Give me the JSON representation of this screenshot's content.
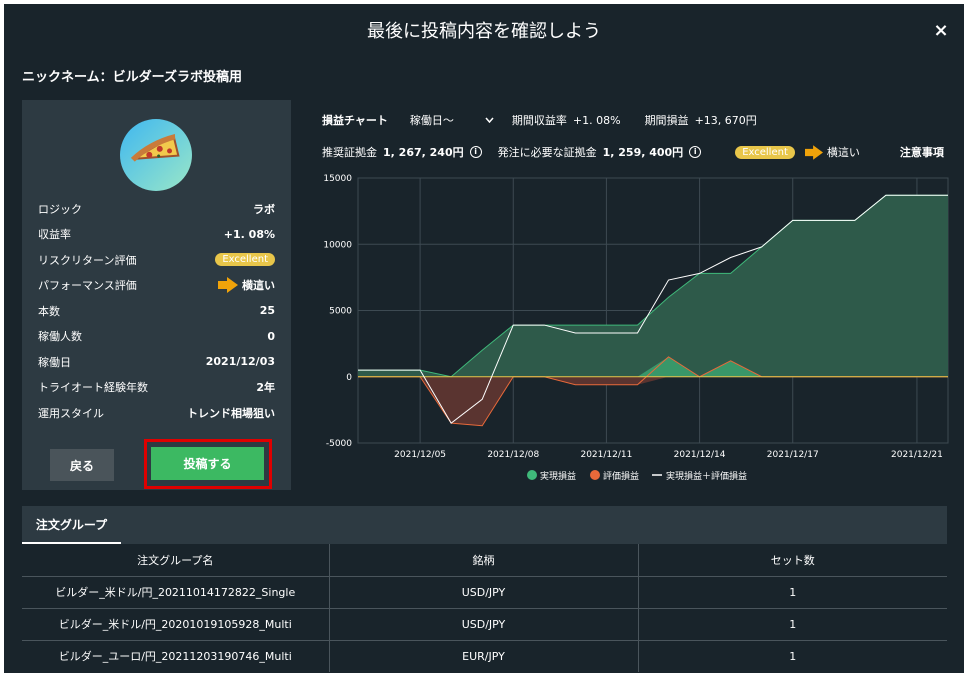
{
  "modal": {
    "title": "最後に投稿内容を確認しよう",
    "close_label": "×"
  },
  "nickname": "ニックネーム：ビルダーズラボ投稿用",
  "profile": {
    "avatar_icon": "pizza-icon",
    "rows": [
      {
        "label": "ロジック",
        "value": "ラボ"
      },
      {
        "label": "収益率",
        "value": "+1. 08%"
      },
      {
        "label": "リスクリターン評価",
        "badge": "Excellent"
      },
      {
        "label": "パフォーマンス評価",
        "arrow_text": "横這い"
      },
      {
        "label": "本数",
        "value": "25"
      },
      {
        "label": "稼働人数",
        "value": "0"
      },
      {
        "label": "稼働日",
        "value": "2021/12/03"
      },
      {
        "label": "トライオート経験年数",
        "value": "2年"
      },
      {
        "label": "運用スタイル",
        "value": "トレンド相場狙い"
      }
    ],
    "back_label": "戻る",
    "post_label": "投稿する"
  },
  "chart_header": {
    "title": "損益チャート",
    "period_select": "稼働日～",
    "period_rate_label": "期間収益率",
    "period_rate_value": "+1. 08%",
    "period_pl_label": "期間損益",
    "period_pl_value": "+13, 670円",
    "recommended_label": "推奨証拠金",
    "recommended_value": "1, 267, 240円",
    "required_label": "発注に必要な証拠金",
    "required_value": "1, 259, 400円",
    "badge": "Excellent",
    "arrow_text": "横這い",
    "notes_label": "注意事項"
  },
  "colors": {
    "accent_green": "#3cb962",
    "badge_yellow": "#e8c64a",
    "arrow_orange": "#f0a30a",
    "realized": "#3fb97a",
    "unrealized": "#e8693a"
  },
  "chart_data": {
    "type": "area",
    "x": [
      "2021/12/03",
      "2021/12/04",
      "2021/12/05",
      "2021/12/06",
      "2021/12/07",
      "2021/12/08",
      "2021/12/09",
      "2021/12/10",
      "2021/12/11",
      "2021/12/12",
      "2021/12/13",
      "2021/12/14",
      "2021/12/15",
      "2021/12/16",
      "2021/12/17",
      "2021/12/18",
      "2021/12/19",
      "2021/12/20",
      "2021/12/21",
      "2021/12/22"
    ],
    "series": [
      {
        "name": "実現損益",
        "values": [
          500,
          500,
          500,
          0,
          2000,
          3900,
          3900,
          3900,
          3900,
          3900,
          6000,
          7800,
          7800,
          9800,
          11800,
          11800,
          11800,
          13700,
          13700,
          13700
        ]
      },
      {
        "name": "評価損益",
        "values": [
          0,
          0,
          0,
          -3500,
          -3700,
          0,
          0,
          -600,
          -600,
          -600,
          1500,
          0,
          1200,
          0,
          0,
          0,
          0,
          0,
          0,
          0
        ]
      },
      {
        "name": "実現損益＋評価損益",
        "values": [
          500,
          500,
          500,
          -3500,
          -1700,
          3900,
          3900,
          3300,
          3300,
          3300,
          7300,
          7800,
          9000,
          9800,
          11800,
          11800,
          11800,
          13700,
          13700,
          13700
        ]
      }
    ],
    "xticks": [
      "2021/12/05",
      "2021/12/08",
      "2021/12/11",
      "2021/12/14",
      "2021/12/17",
      "2021/12/21"
    ],
    "yticks": [
      "15000",
      "10000",
      "5000",
      "0",
      "-5000"
    ],
    "ylim": [
      -5000,
      15000
    ],
    "grid": true,
    "legend_position": "bottom"
  },
  "order_groups": {
    "tab_label": "注文グループ",
    "headers": [
      "注文グループ名",
      "銘柄",
      "セット数"
    ],
    "rows": [
      [
        "ビルダー_米ドル/円_20211014172822_Single",
        "USD/JPY",
        "1"
      ],
      [
        "ビルダー_米ドル/円_20201019105928_Multi",
        "USD/JPY",
        "1"
      ],
      [
        "ビルダー_ユーロ/円_20211203190746_Multi",
        "EUR/JPY",
        "1"
      ]
    ]
  }
}
